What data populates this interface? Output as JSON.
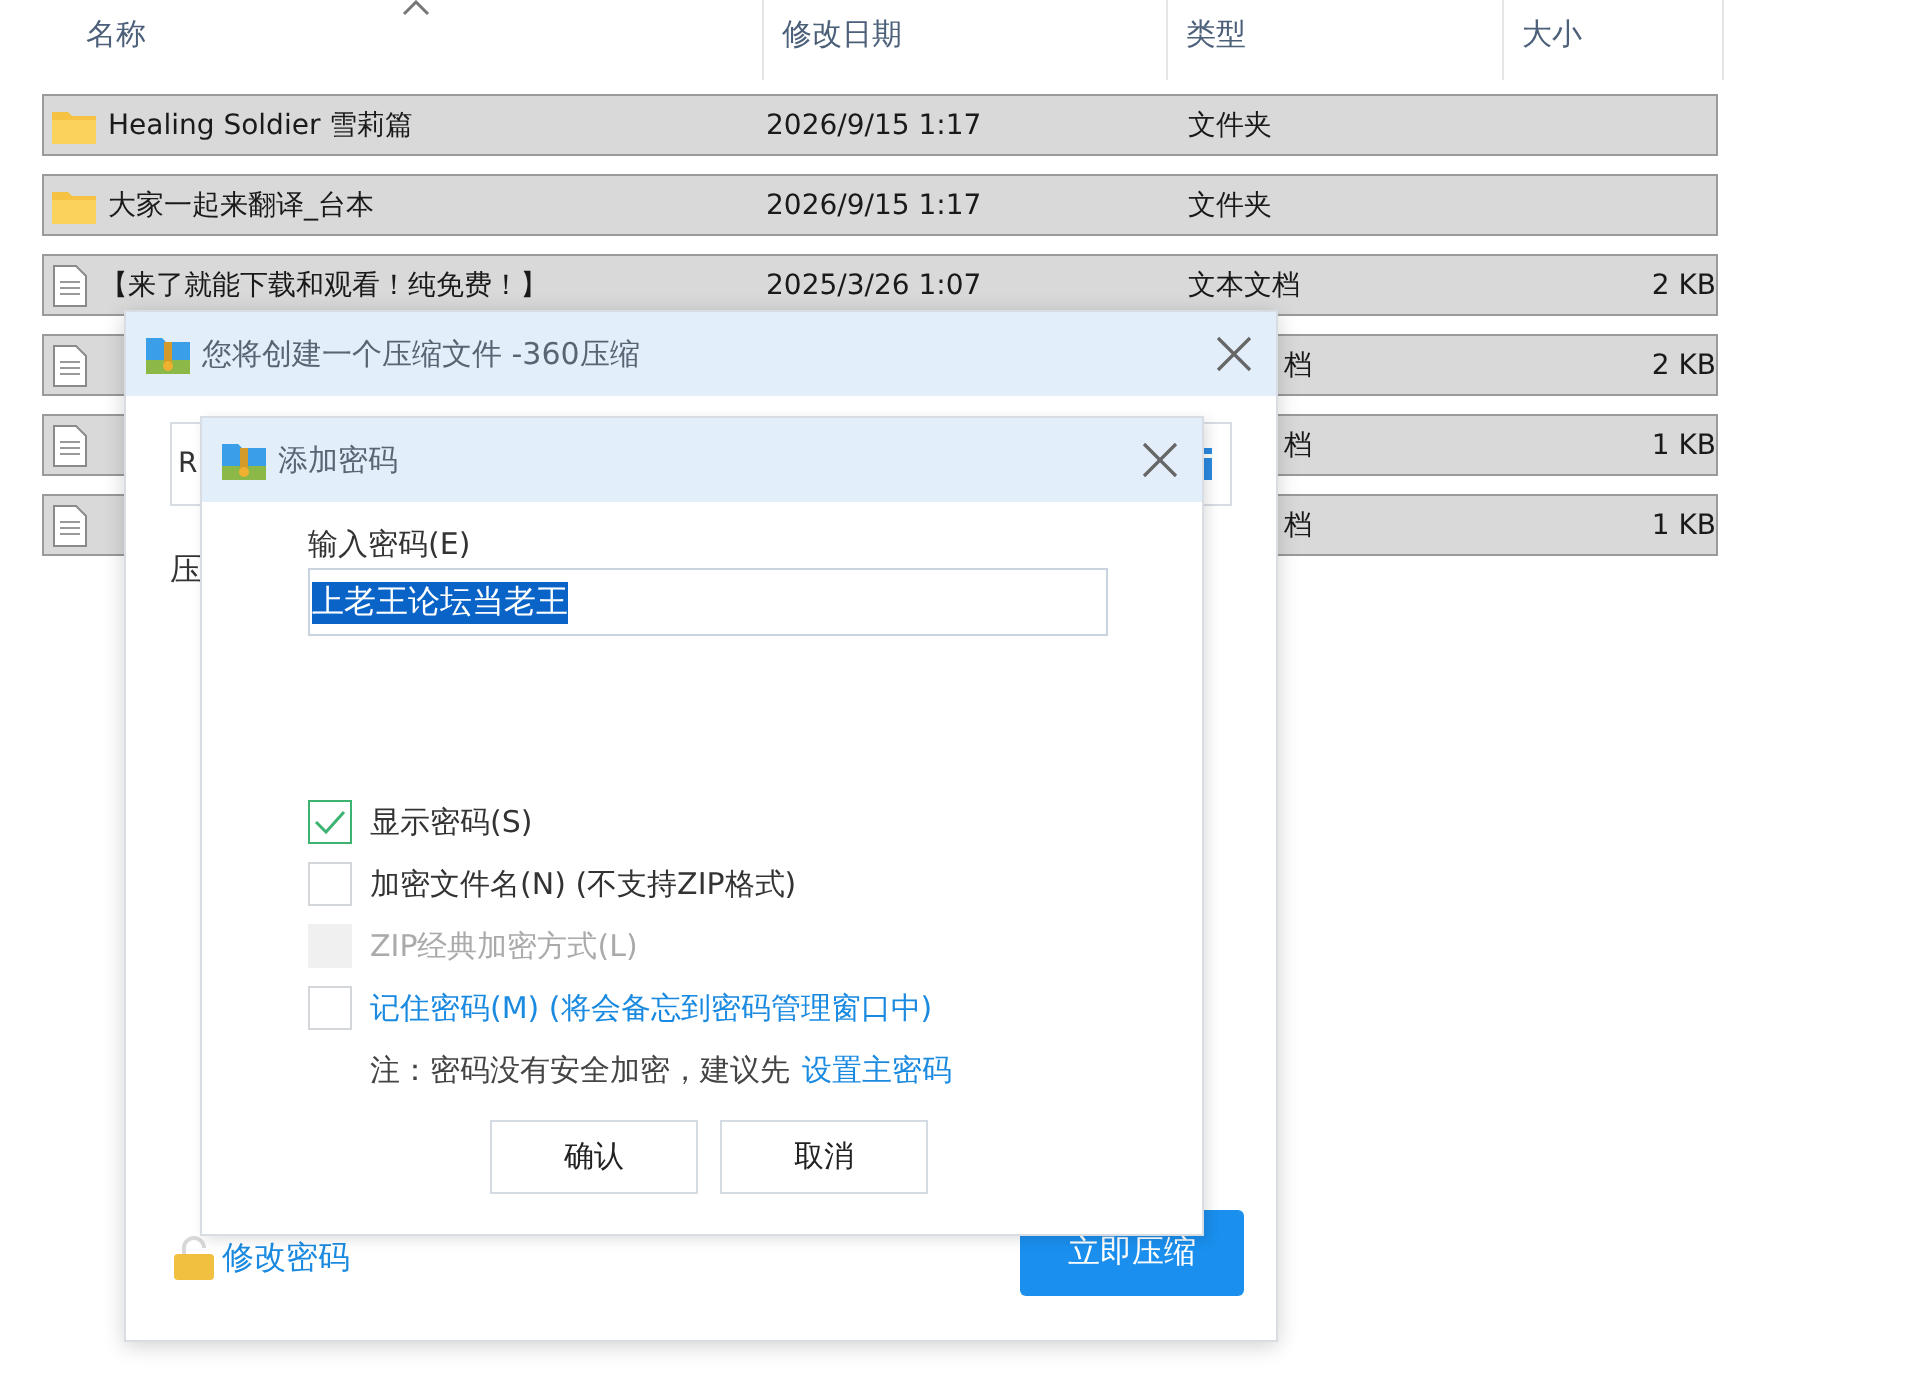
{
  "explorer": {
    "columns": [
      {
        "label": "名称"
      },
      {
        "label": "修改日期"
      },
      {
        "label": "类型"
      },
      {
        "label": "大小"
      }
    ],
    "rows": [
      {
        "kind": "folder",
        "selected": true,
        "name": "Healing Soldier 雪莉篇",
        "date": "2026/9/15 1:17",
        "type": "文件夹"
      },
      {
        "kind": "folder",
        "selected": true,
        "name": "大家一起来翻译_台本",
        "date": "2026/9/15 1:17",
        "type": "文件夹"
      },
      {
        "kind": "file",
        "selected": true,
        "name": "【来了就能下载和观看！纯免费！】",
        "date": "2025/3/26 1:07",
        "type": "文本文档",
        "size": "2 KB"
      },
      {
        "kind": "file",
        "selected": true,
        "type": "档",
        "size": "2 KB"
      },
      {
        "kind": "file",
        "selected": true,
        "type": "档",
        "size": "1 KB"
      },
      {
        "kind": "file",
        "selected": true,
        "type": "档",
        "size": "1 KB"
      }
    ]
  },
  "compress_dialog": {
    "title": "您将创建一个压缩文件 -360压缩",
    "path_value": "R",
    "label_fragment": "压",
    "change_password_link": "修改密码",
    "compress_button": "立即压缩"
  },
  "password_dialog": {
    "title": "添加密码",
    "password_label": "输入密码(E)",
    "password_value": "上老王论坛当老王",
    "value_selected": true,
    "options": [
      {
        "kind": "plain",
        "label": "显示密码(S)",
        "checked": true,
        "disabled": false
      },
      {
        "kind": "plain",
        "label": "加密文件名(N) (不支持ZIP格式)",
        "checked": false,
        "disabled": false
      },
      {
        "kind": "plain",
        "label": "ZIP经典加密方式(L)",
        "checked": false,
        "disabled": true
      },
      {
        "kind": "link",
        "label": "记住密码(M) (将会备忘到密码管理窗口中)",
        "checked": false,
        "disabled": false
      }
    ],
    "note": "注：密码没有安全加密，建议先",
    "note_link": "设置主密码",
    "buttons": [
      {
        "label": "确认"
      },
      {
        "label": "取消"
      }
    ]
  }
}
